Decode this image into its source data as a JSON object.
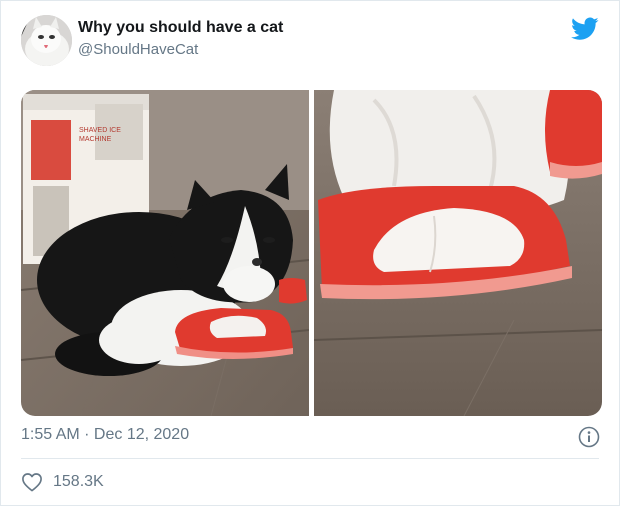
{
  "tweet": {
    "display_name": "Why you should have a cat",
    "handle": "@ShouldHaveCat",
    "timestamp": "1:55 AM · Dec 12, 2020",
    "like_count": "158.3K"
  },
  "media": {
    "box_text": "SHAVED ICE MACHINE"
  },
  "colors": {
    "twitter_blue": "#1da1f2",
    "secondary_text": "#657786",
    "primary_text": "#14171a",
    "divider": "#e1e8ed",
    "slipper_red": "#e03a2f"
  },
  "icons": {
    "brand": "twitter-bird-icon",
    "info": "info-icon",
    "like": "heart-icon"
  }
}
